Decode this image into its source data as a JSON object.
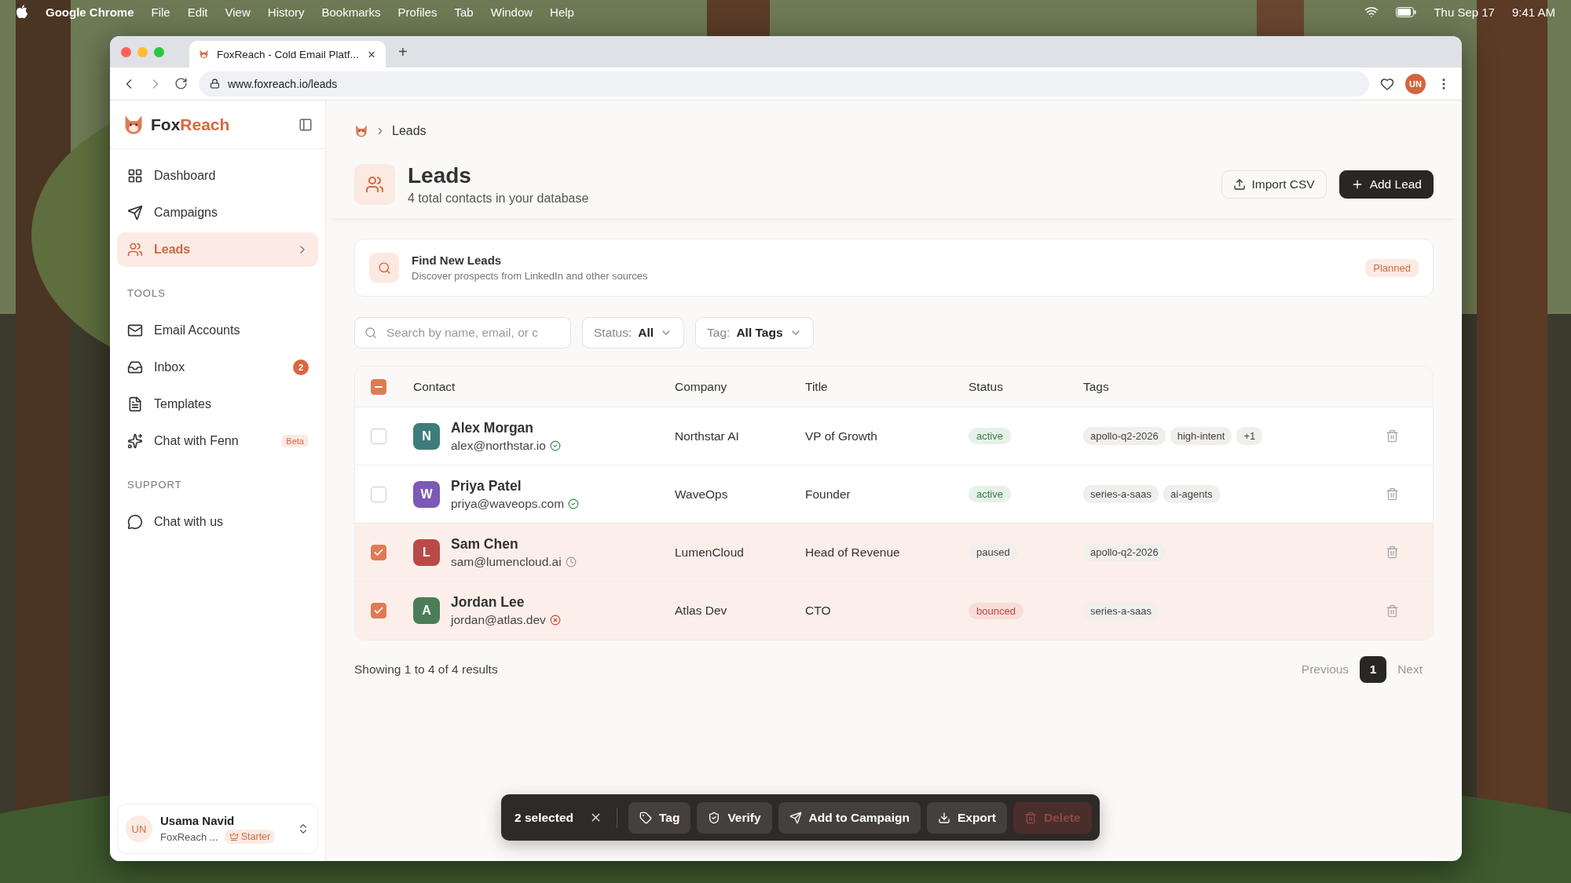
{
  "menubar": {
    "app": "Google Chrome",
    "menus": [
      "File",
      "Edit",
      "View",
      "History",
      "Bookmarks",
      "Profiles",
      "Tab",
      "Window",
      "Help"
    ],
    "date": "Thu Sep 17",
    "time": "9:41 AM"
  },
  "browser": {
    "tab_title": "FoxReach - Cold Email Platf...",
    "new_tab": "+",
    "url": "www.foxreach.io/leads",
    "profile": "UN"
  },
  "sidebar": {
    "brand_a": "Fox",
    "brand_b": "Reach",
    "nav": [
      {
        "label": "Dashboard",
        "selected": false
      },
      {
        "label": "Campaigns",
        "selected": false
      },
      {
        "label": "Leads",
        "selected": true
      }
    ],
    "sections": [
      {
        "title": "TOOLS",
        "items": [
          {
            "label": "Email Accounts"
          },
          {
            "label": "Inbox",
            "badge": "2"
          },
          {
            "label": "Templates"
          },
          {
            "label": "Chat with Fenn",
            "tag": "Beta"
          }
        ]
      },
      {
        "title": "SUPPORT",
        "items": [
          {
            "label": "Chat with us"
          }
        ]
      }
    ],
    "user": {
      "initials": "UN",
      "name": "Usama Navid",
      "org": "FoxReach ...",
      "plan": "Starter"
    }
  },
  "breadcrumb": {
    "current": "Leads"
  },
  "header": {
    "title": "Leads",
    "subtitle": "4 total contacts in your database",
    "import_button": "Import CSV",
    "add_button": "Add Lead"
  },
  "promo": {
    "title": "Find New Leads",
    "text": "Discover prospects from LinkedIn and other sources",
    "badge": "Planned"
  },
  "filters": {
    "search_placeholder": "Search by name, email, or c",
    "status_label": "Status:",
    "status_value": "All",
    "tag_label": "Tag:",
    "tag_value": "All Tags"
  },
  "table": {
    "mixed": true,
    "columns": [
      "Contact",
      "Company",
      "Title",
      "Status",
      "Tags"
    ],
    "rows": [
      {
        "selected": false,
        "initial": "N",
        "color": "#3e7c7b",
        "name": "Alex Morgan",
        "email": {
          "text": "alex@northstar.io",
          "kind": "verified"
        },
        "company": "Northstar AI",
        "title": "VP of Growth",
        "status": "active",
        "tags": [
          "apollo-q2-2026",
          "high-intent",
          "+1"
        ]
      },
      {
        "selected": false,
        "initial": "W",
        "color": "#7b59b5",
        "name": "Priya Patel",
        "email": {
          "text": "priya@waveops.com",
          "kind": "verified"
        },
        "company": "WaveOps",
        "title": "Founder",
        "status": "active",
        "tags": [
          "series-a-saas",
          "ai-agents"
        ]
      },
      {
        "selected": true,
        "initial": "L",
        "color": "#b94a48",
        "name": "Sam Chen",
        "email": {
          "text": "sam@lumencloud.ai",
          "kind": "pending"
        },
        "company": "LumenCloud",
        "title": "Head of Revenue",
        "status": "paused",
        "tags": [
          "apollo-q2-2026"
        ]
      },
      {
        "selected": true,
        "initial": "A",
        "color": "#4a7d58",
        "name": "Jordan Lee",
        "email": {
          "text": "jordan@atlas.dev",
          "kind": "invalid"
        },
        "company": "Atlas Dev",
        "title": "CTO",
        "status": "bounced",
        "tags": [
          "series-a-saas"
        ]
      }
    ]
  },
  "pagination": {
    "summary": "Showing 1 to 4 of 4 results",
    "previous": "Previous",
    "page": "1",
    "next": "Next"
  },
  "bulk_bar": {
    "count": "2 selected",
    "actions": [
      {
        "label": "Tag",
        "disabled": false
      },
      {
        "label": "Verify",
        "disabled": false
      },
      {
        "label": "Add to Campaign",
        "disabled": false
      },
      {
        "label": "Export",
        "disabled": false
      },
      {
        "label": "Delete",
        "disabled": true
      }
    ]
  }
}
